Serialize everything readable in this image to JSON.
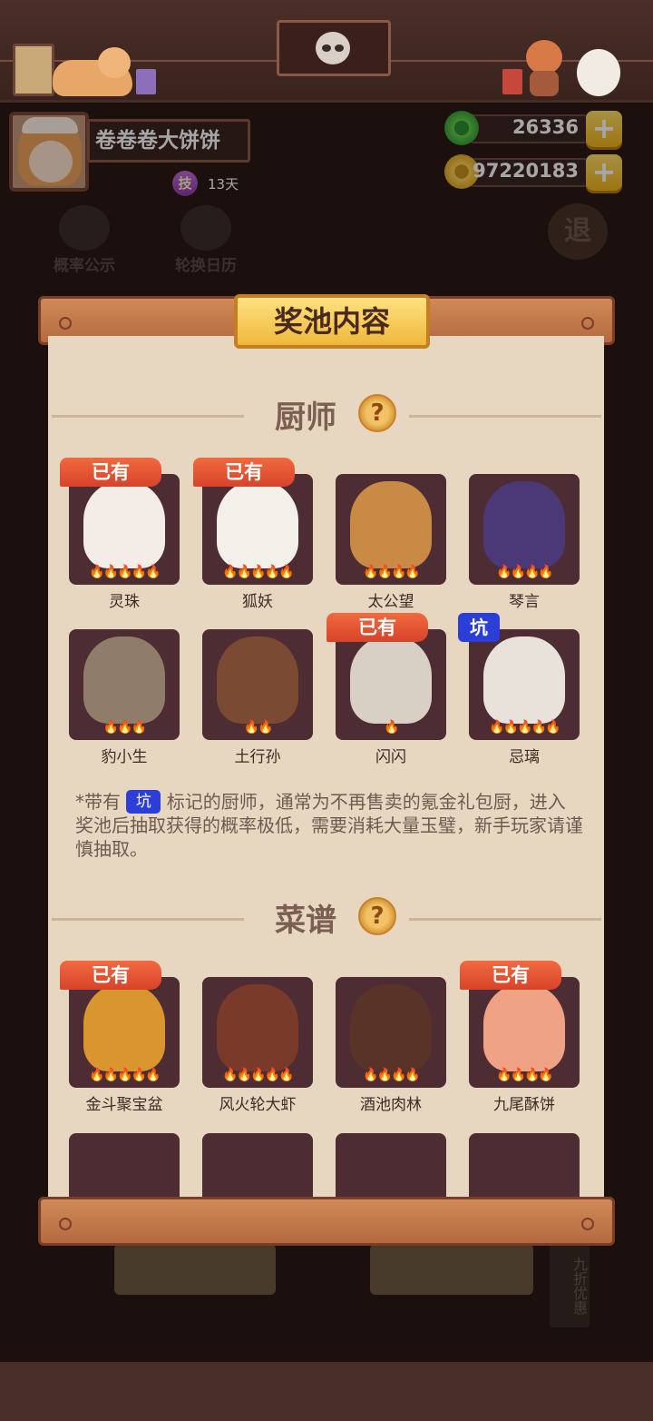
{
  "profile": {
    "username": "卷卷卷大饼饼",
    "skill_badge": "技",
    "days": "13天"
  },
  "currency": {
    "jade": "26336",
    "coins": "97220183",
    "plus_symbol": "+"
  },
  "background": {
    "probability_label": "概率公示",
    "rotation_label": "轮换日历",
    "exit_label": "退",
    "discount_label": "九折优惠"
  },
  "modal": {
    "title": "奖池内容",
    "chef_section_title": "厨师",
    "recipe_section_title": "菜谱",
    "owned_label": "已有",
    "pit_label": "坑",
    "help_symbol": "?",
    "note_before": "*带有",
    "note_after": "标记的厨师，通常为不再售卖的氪金礼包厨，进入奖池后抽取获得的概率极低，需要消耗大量玉璧，新手玩家请谨慎抽取。"
  },
  "chefs": [
    {
      "name": "灵珠",
      "stars": "🔥🔥🔥🔥🔥",
      "owned": true,
      "pit": false,
      "color": "#f4ece6"
    },
    {
      "name": "狐妖",
      "stars": "🔥🔥🔥🔥🔥",
      "owned": true,
      "pit": false,
      "color": "#f3efe9"
    },
    {
      "name": "太公望",
      "stars": "🔥🔥🔥🔥",
      "owned": false,
      "pit": false,
      "color": "#c98a45"
    },
    {
      "name": "琴言",
      "stars": "🔥🔥🔥🔥",
      "owned": false,
      "pit": false,
      "color": "#4a3877"
    },
    {
      "name": "豹小生",
      "stars": "🔥🔥🔥",
      "owned": false,
      "pit": false,
      "color": "#8f7d69"
    },
    {
      "name": "土行孙",
      "stars": "🔥🔥",
      "owned": false,
      "pit": false,
      "color": "#7a4a32"
    },
    {
      "name": "闪闪",
      "stars": "🔥",
      "owned": true,
      "pit": false,
      "color": "#d8d0c4"
    },
    {
      "name": "忌璃",
      "stars": "🔥🔥🔥🔥🔥",
      "owned": false,
      "pit": true,
      "color": "#e8e2da"
    }
  ],
  "recipes": [
    {
      "name": "金斗聚宝盆",
      "stars": "🔥🔥🔥🔥🔥",
      "owned": true,
      "color": "#d9962f"
    },
    {
      "name": "风火轮大虾",
      "stars": "🔥🔥🔥🔥🔥",
      "owned": false,
      "color": "#7a3a2a"
    },
    {
      "name": "酒池肉林",
      "stars": "🔥🔥🔥🔥",
      "owned": false,
      "color": "#5a3328"
    },
    {
      "name": "九尾酥饼",
      "stars": "🔥🔥🔥🔥",
      "owned": true,
      "color": "#f0a285"
    }
  ]
}
